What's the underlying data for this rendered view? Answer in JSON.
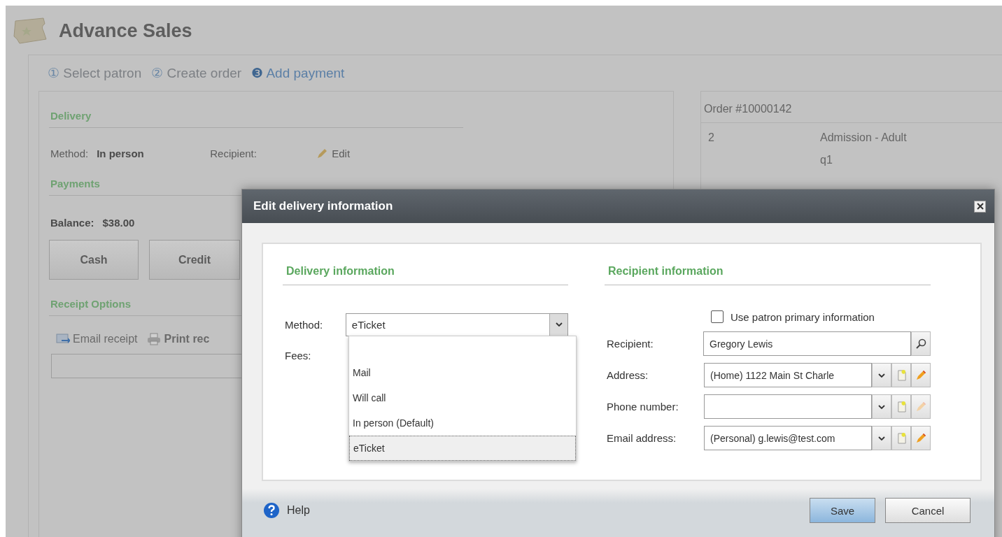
{
  "page": {
    "title": "Advance Sales"
  },
  "steps": [
    {
      "number": "①",
      "label": "Select patron",
      "selected": false
    },
    {
      "number": "②",
      "label": "Create order",
      "selected": false
    },
    {
      "number": "❸",
      "label": "Add payment",
      "selected": true
    }
  ],
  "delivery": {
    "heading": "Delivery",
    "method_label": "Method:",
    "method": "In person",
    "recipient_label": "Recipient:",
    "edit_link": "Edit"
  },
  "payments": {
    "heading": "Payments",
    "balance_label": "Balance:",
    "balance": "$38.00",
    "buttons": [
      "Cash",
      "Credit"
    ]
  },
  "receipt_options": {
    "heading": "Receipt Options",
    "actions": [
      {
        "kind": "email",
        "label": "Email receipt"
      },
      {
        "kind": "print",
        "label": "Print rec"
      }
    ]
  },
  "order": {
    "title": "Order #10000142",
    "lines": [
      {
        "quantity": "2",
        "description": [
          "Admission - Adult",
          "q1"
        ]
      }
    ]
  },
  "dialog": {
    "title": "Edit delivery information",
    "delivery": {
      "heading": "Delivery information",
      "method_label": "Method:",
      "method_value": "eTicket",
      "expanded": true,
      "fees_label": "Fees:",
      "options": [
        {
          "label": "Mail",
          "selected": false
        },
        {
          "label": "Will call",
          "selected": false
        },
        {
          "label": "In person (Default)",
          "selected": false
        },
        {
          "label": "eTicket",
          "selected": true
        }
      ]
    },
    "recipient": {
      "heading": "Recipient information",
      "use_primary": {
        "label": "Use patron primary information",
        "checked": false
      },
      "fields": [
        {
          "kind": "search",
          "label": "Recipient:",
          "value": "Gregory Lewis"
        },
        {
          "kind": "combo",
          "label": "Address:",
          "value": "(Home) 1122 Main St Charle",
          "edit_enabled": true
        },
        {
          "kind": "combo",
          "label": "Phone number:",
          "edit_enabled": false
        },
        {
          "kind": "combo",
          "label": "Email address:",
          "value": "(Personal) g.lewis@test.com",
          "edit_enabled": true
        }
      ]
    },
    "help": "Help",
    "buttons": [
      {
        "label": "Save",
        "primary": true
      },
      {
        "label": "Cancel",
        "primary": false
      }
    ]
  }
}
